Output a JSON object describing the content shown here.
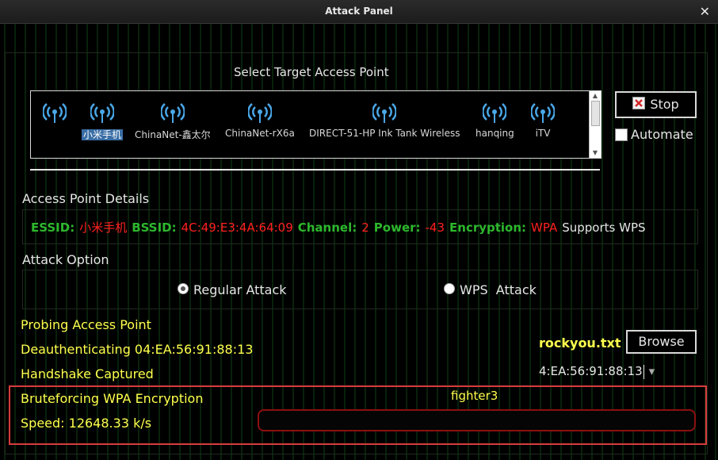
{
  "window": {
    "title": "Attack Panel",
    "close_glyph": "✕"
  },
  "target_section": {
    "heading": "Select Target Access Point",
    "access_points": [
      {
        "label": "小米手机",
        "selected": true
      },
      {
        "label": "ChinaNet-鑫太尔",
        "selected": false
      },
      {
        "label": "ChinaNet-rX6a",
        "selected": false
      },
      {
        "label": "DIRECT-51-HP Ink Tank Wireless",
        "selected": false
      },
      {
        "label": "hanqing",
        "selected": false
      },
      {
        "label": "iTV",
        "selected": false
      }
    ],
    "icon": "wifi-signal-icon"
  },
  "controls": {
    "stop_label": "Stop",
    "stop_icon": "close-box-icon",
    "automate_label": "Automate",
    "automate_checked": false
  },
  "details": {
    "heading": "Access Point Details",
    "essid_key": "ESSID:",
    "essid_value": "小米手机",
    "bssid_key": "BSSID:",
    "bssid_value": "4C:49:E3:4A:64:09",
    "channel_key": "Channel:",
    "channel_value": "2",
    "power_key": "Power:",
    "power_value": "-43",
    "encryption_key": "Encryption:",
    "encryption_value": "WPA",
    "wps_text": "Supports WPS"
  },
  "attack_option": {
    "heading": "Attack Option",
    "regular_label": "Regular Attack",
    "regular_selected": true,
    "wps_label": "WPS  Attack",
    "wps_selected": false
  },
  "status": {
    "line1": "Probing Access Point",
    "line2": "Deauthenticating 04:EA:56:91:88:13",
    "line3": "Handshake Captured",
    "line4": "Bruteforcing WPA Encryption",
    "speed": "Speed: 12648.33 k/s"
  },
  "wordlist": {
    "file": "rockyou.txt",
    "browse_label": "Browse"
  },
  "client_combo": {
    "value": "4:EA:56:91:88:13",
    "arrow": "▾"
  },
  "bruteforce": {
    "current_key": "fighter3",
    "progress_fraction": 0.0
  },
  "colors": {
    "label_green": "#2db82d",
    "value_red": "#ff2020",
    "status_yellow": "#ffff4d",
    "progress_border": "#d83c3c"
  }
}
